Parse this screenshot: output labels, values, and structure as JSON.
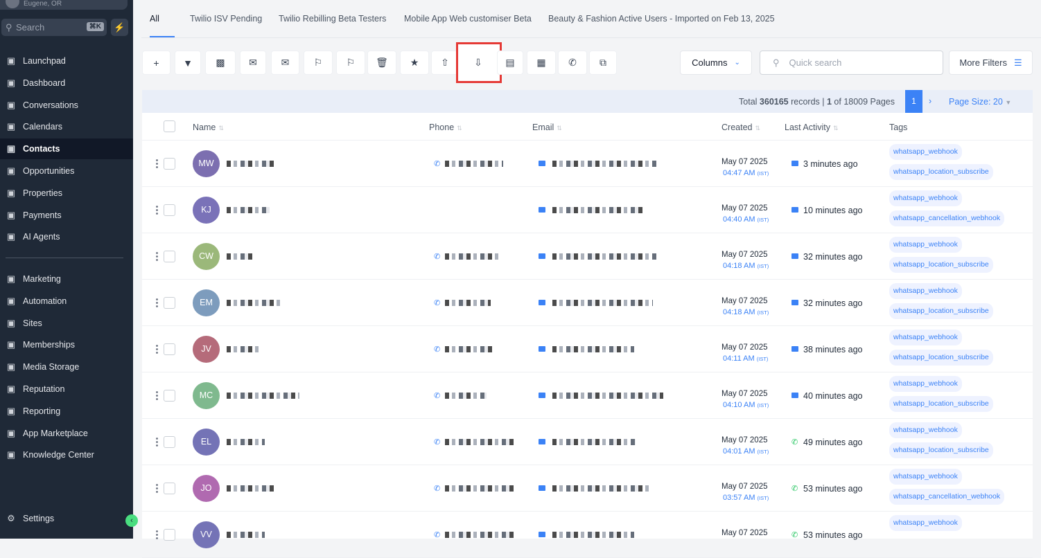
{
  "sidebar": {
    "location": "Eugene, OR",
    "search_label": "Search",
    "search_shortcut": "⌘K",
    "nav": [
      {
        "label": "Launchpad",
        "icon": "launchpad-icon"
      },
      {
        "label": "Dashboard",
        "icon": "dashboard-icon"
      },
      {
        "label": "Conversations",
        "icon": "chat-icon"
      },
      {
        "label": "Calendars",
        "icon": "calendar-icon"
      },
      {
        "label": "Contacts",
        "icon": "contacts-icon"
      },
      {
        "label": "Opportunities",
        "icon": "opportunities-icon"
      },
      {
        "label": "Properties",
        "icon": "home-icon"
      },
      {
        "label": "Payments",
        "icon": "receipt-icon"
      },
      {
        "label": "AI Agents",
        "icon": "sparkle-icon"
      }
    ],
    "nav2": [
      {
        "label": "Marketing",
        "icon": "send-icon"
      },
      {
        "label": "Automation",
        "icon": "automation-icon"
      },
      {
        "label": "Sites",
        "icon": "sites-icon"
      },
      {
        "label": "Memberships",
        "icon": "membership-icon"
      },
      {
        "label": "Media Storage",
        "icon": "image-icon"
      },
      {
        "label": "Reputation",
        "icon": "star-icon"
      },
      {
        "label": "Reporting",
        "icon": "trend-icon"
      },
      {
        "label": "App Marketplace",
        "icon": "grid-icon"
      },
      {
        "label": "Knowledge Center",
        "icon": "info-icon"
      }
    ],
    "settings": "Settings"
  },
  "tabs": [
    "All",
    "Twilio ISV Pending",
    "Twilio Rebilling Beta Testers",
    "Mobile App Web customiser Beta",
    "Beauty & Fashion Active Users - Imported on Feb 13, 2025"
  ],
  "toolbar": {
    "columns_label": "Columns",
    "quick_search_placeholder": "Quick search",
    "more_filters_label": "More Filters"
  },
  "pagination": {
    "total_prefix": "Total ",
    "total": "360165",
    "records_text": " records | ",
    "page": "1",
    "of_text": " of 18009 Pages",
    "current": "1",
    "page_size": "Page Size: 20"
  },
  "table": {
    "headers": {
      "name": "Name",
      "phone": "Phone",
      "email": "Email",
      "created": "Created",
      "last_activity": "Last Activity",
      "tags": "Tags"
    },
    "rows": [
      {
        "initials": "MW",
        "color": "#7c6fb0",
        "date": "May 07 2025",
        "time": "04:47 AM",
        "tz": "(IST)",
        "activity": "3 minutes ago",
        "channel": "email",
        "has_phone": true,
        "tags": [
          "whatsapp_webhook",
          "whatsapp_location_subscribe"
        ]
      },
      {
        "initials": "KJ",
        "color": "#7a72b8",
        "date": "May 07 2025",
        "time": "04:40 AM",
        "tz": "(IST)",
        "activity": "10 minutes ago",
        "channel": "email",
        "has_phone": false,
        "tags": [
          "whatsapp_webhook",
          "whatsapp_cancellation_webhook"
        ]
      },
      {
        "initials": "CW",
        "color": "#9bb87a",
        "date": "May 07 2025",
        "time": "04:18 AM",
        "tz": "(IST)",
        "activity": "32 minutes ago",
        "channel": "email",
        "has_phone": true,
        "tags": [
          "whatsapp_webhook",
          "whatsapp_location_subscribe"
        ]
      },
      {
        "initials": "EM",
        "color": "#7d9cbd",
        "date": "May 07 2025",
        "time": "04:18 AM",
        "tz": "(IST)",
        "activity": "32 minutes ago",
        "channel": "email",
        "has_phone": true,
        "tags": [
          "whatsapp_webhook",
          "whatsapp_location_subscribe"
        ]
      },
      {
        "initials": "JV",
        "color": "#b56b7a",
        "date": "May 07 2025",
        "time": "04:11 AM",
        "tz": "(IST)",
        "activity": "38 minutes ago",
        "channel": "email",
        "has_phone": true,
        "tags": [
          "whatsapp_webhook",
          "whatsapp_location_subscribe"
        ]
      },
      {
        "initials": "MC",
        "color": "#7fb98e",
        "date": "May 07 2025",
        "time": "04:10 AM",
        "tz": "(IST)",
        "activity": "40 minutes ago",
        "channel": "email",
        "has_phone": true,
        "tags": [
          "whatsapp_webhook",
          "whatsapp_location_subscribe"
        ]
      },
      {
        "initials": "EL",
        "color": "#7473b6",
        "date": "May 07 2025",
        "time": "04:01 AM",
        "tz": "(IST)",
        "activity": "49 minutes ago",
        "channel": "whatsapp",
        "has_phone": true,
        "tags": [
          "whatsapp_webhook",
          "whatsapp_location_subscribe"
        ]
      },
      {
        "initials": "JO",
        "color": "#b06ab0",
        "date": "May 07 2025",
        "time": "03:57 AM",
        "tz": "(IST)",
        "activity": "53 minutes ago",
        "channel": "whatsapp",
        "has_phone": true,
        "tags": [
          "whatsapp_webhook",
          "whatsapp_cancellation_webhook"
        ]
      },
      {
        "initials": "VV",
        "color": "#7473b6",
        "date": "May 07 2025",
        "time": "",
        "tz": "",
        "activity": "53 minutes ago",
        "channel": "whatsapp",
        "has_phone": true,
        "tags": [
          "whatsapp_webhook"
        ]
      }
    ]
  },
  "colors": {
    "accent": "#3b82f6",
    "sidebar": "#1f2937",
    "highlight": "#e53935",
    "whatsapp": "#22c55e"
  }
}
